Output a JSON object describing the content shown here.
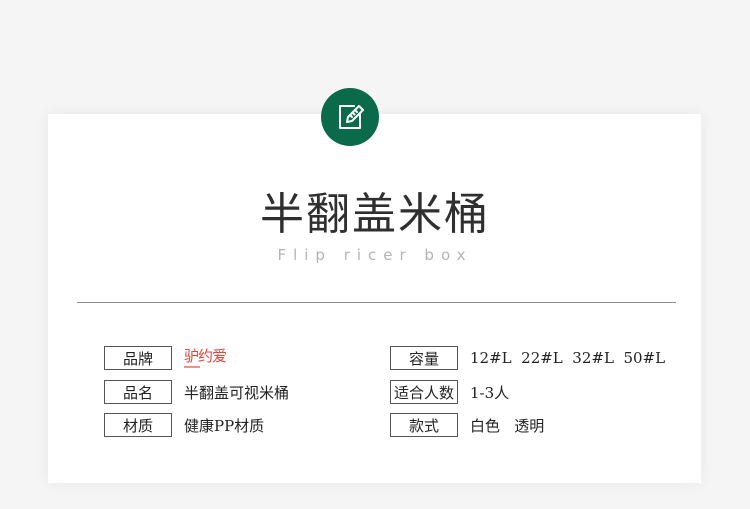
{
  "header": {
    "title": "半翻盖米桶",
    "subtitle": "Flip ricer box"
  },
  "specs_left": [
    {
      "label": "品牌",
      "value": "",
      "brand_logo": "驴约爱"
    },
    {
      "label": "品名",
      "value": "半翻盖可视米桶"
    },
    {
      "label": "材质",
      "value": "健康PP材质"
    }
  ],
  "specs_right": [
    {
      "label": "容量",
      "value": "12#L  22#L  32#L  50#L"
    },
    {
      "label": "适合人数",
      "value": "1-3人"
    },
    {
      "label": "款式",
      "value": "白色   透明"
    }
  ],
  "icons": {
    "badge": "edit-note-icon"
  },
  "colors": {
    "badge_bg": "#0b6a4a",
    "brand_red": "#e2473f",
    "background": "#f5f5f5",
    "card": "#ffffff"
  }
}
